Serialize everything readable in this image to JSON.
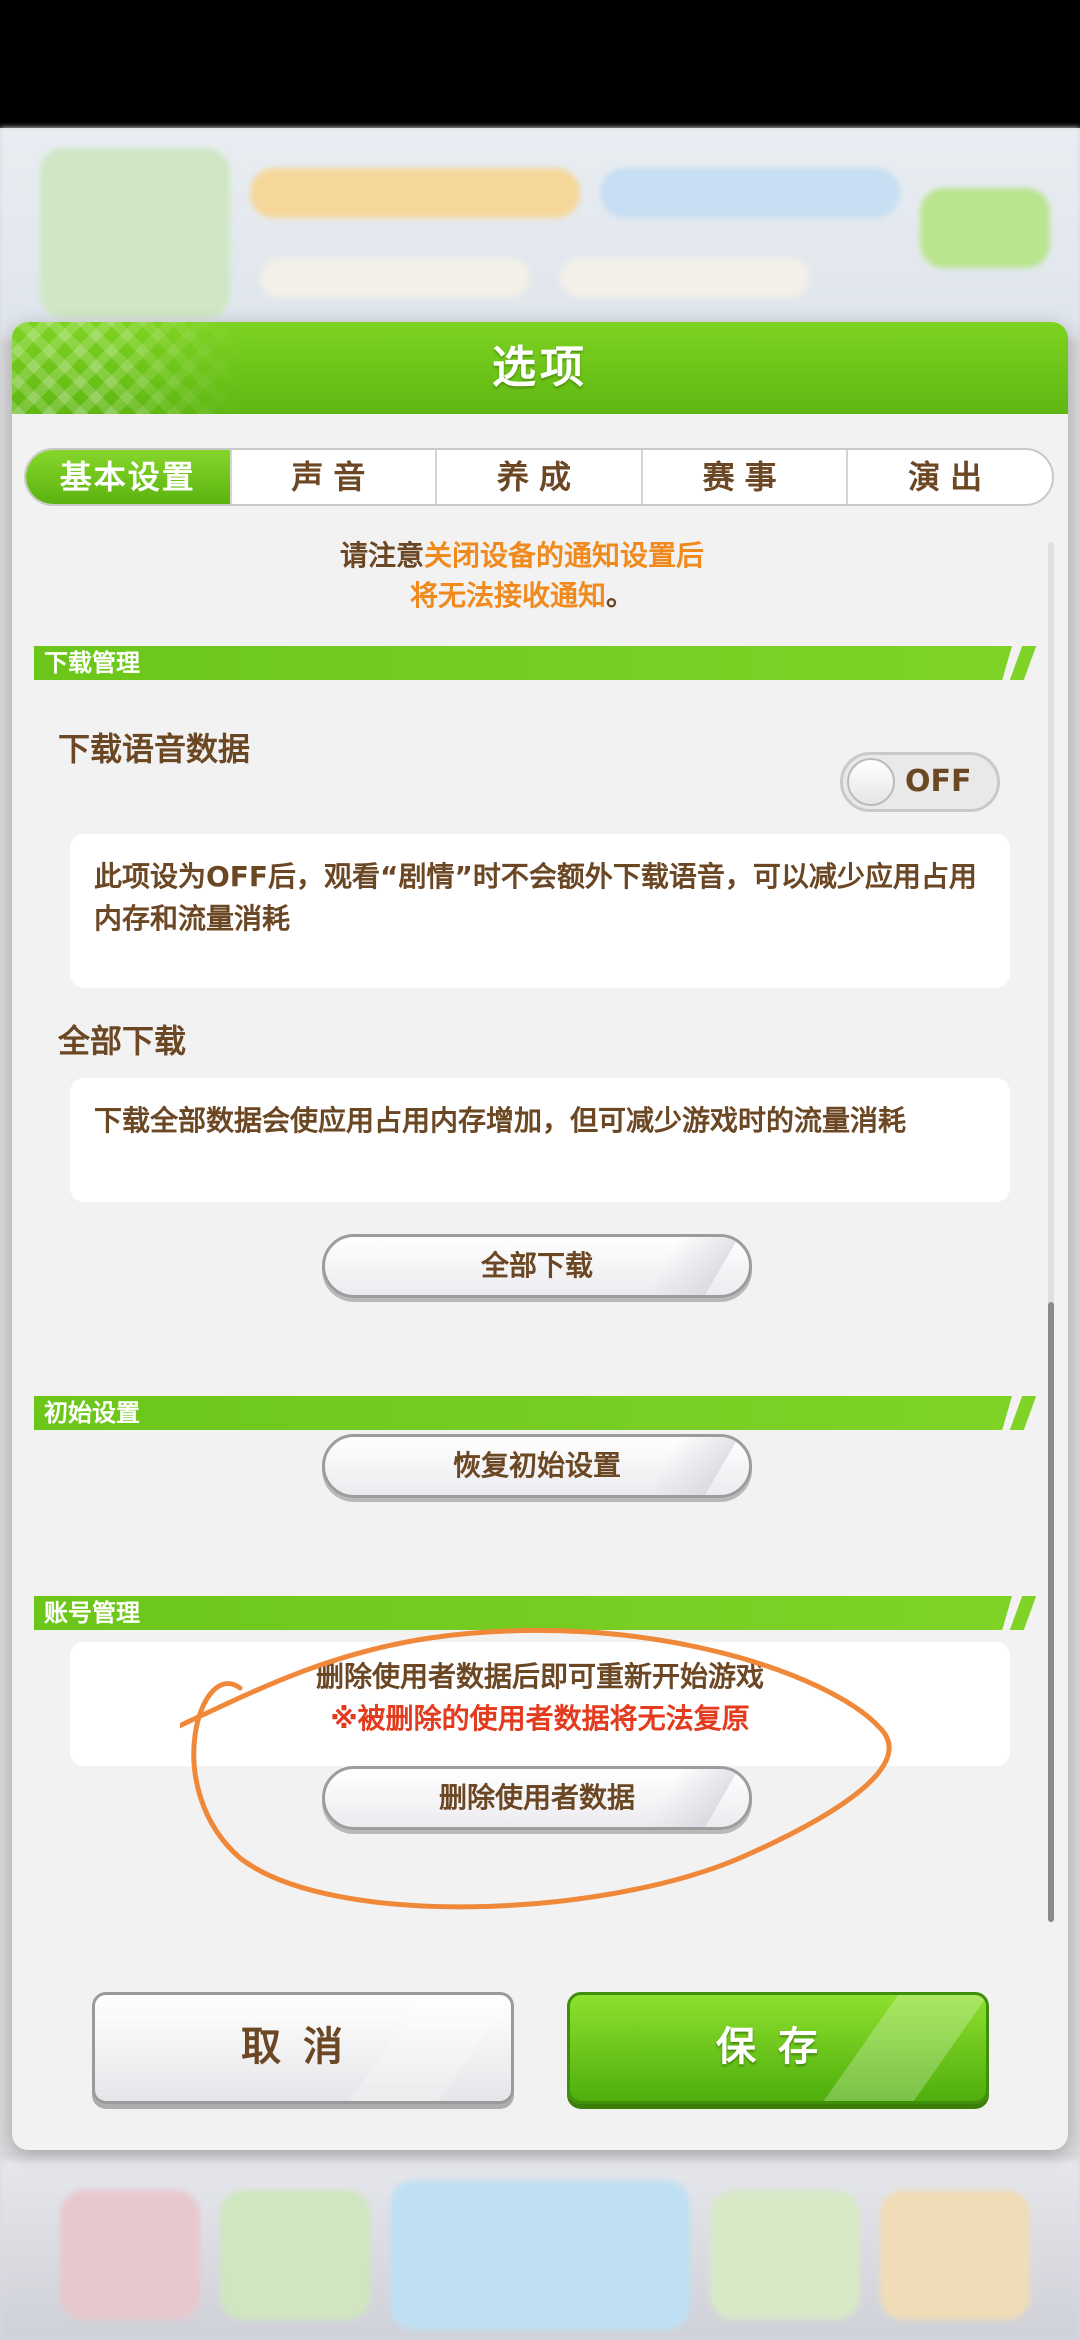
{
  "dialog": {
    "title": "选项"
  },
  "tabs": [
    {
      "label": "基本设置",
      "active": true
    },
    {
      "label": "声音",
      "active": false
    },
    {
      "label": "养成",
      "active": false
    },
    {
      "label": "赛事",
      "active": false
    },
    {
      "label": "演出",
      "active": false
    }
  ],
  "notice": {
    "line1_prefix": "请注意",
    "line1_highlight": "关闭设备的通知设置后",
    "line2": "将无法接收通知",
    "line2_suffix": "。"
  },
  "download_section": {
    "header": "下载管理",
    "voice_title": "下载语音数据",
    "voice_toggle": "OFF",
    "voice_desc": "此项设为OFF后，观看“剧情”时不会额外下载语音，可以减少应用占用内存和流量消耗",
    "all_title": "全部下载",
    "all_desc": "下载全部数据会使应用占用内存增加，但可减少游戏时的流量消耗",
    "all_button": "全部下载"
  },
  "init_section": {
    "header": "初始设置",
    "reset_button": "恢复初始设置"
  },
  "account_section": {
    "header": "账号管理",
    "desc": "删除使用者数据后即可重新开始游戏",
    "warning": "※被删除的使用者数据将无法复原",
    "delete_button": "删除使用者数据"
  },
  "footer": {
    "cancel": "取消",
    "save": "保存"
  },
  "colors": {
    "accent_green": "#6cc61a",
    "text_brown": "#6b4724",
    "highlight_orange": "#f08a1c",
    "warning_red": "#e23b1e",
    "annotation_orange": "#f0883a"
  }
}
